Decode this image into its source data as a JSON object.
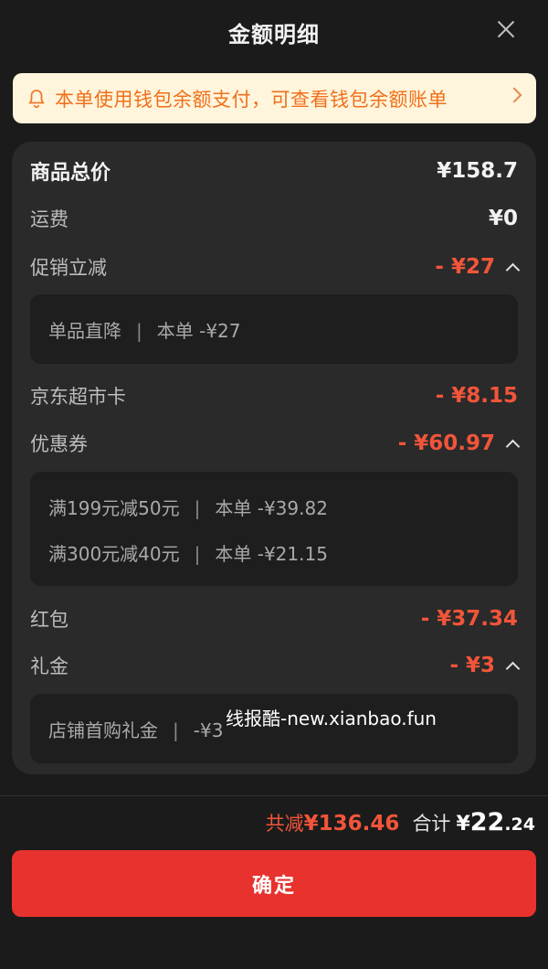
{
  "header": {
    "title": "金额明细"
  },
  "notice": {
    "text": "本单使用钱包余额支付，可查看钱包余额账单"
  },
  "rows": {
    "total": {
      "label": "商品总价",
      "amount": "¥158.7"
    },
    "shipping": {
      "label": "运费",
      "amount": "¥0"
    },
    "promo": {
      "label": "促销立减",
      "amount": "- ¥27",
      "details": [
        {
          "name": "单品直降",
          "value": "本单 -¥27"
        }
      ]
    },
    "jdcard": {
      "label": "京东超市卡",
      "amount": "- ¥8.15"
    },
    "coupon": {
      "label": "优惠券",
      "amount": "- ¥60.97",
      "details": [
        {
          "name": "满199元减50元",
          "value": "本单 -¥39.82"
        },
        {
          "name": "满300元减40元",
          "value": "本单 -¥21.15"
        }
      ]
    },
    "redpacket": {
      "label": "红包",
      "amount": "- ¥37.34"
    },
    "gift": {
      "label": "礼金",
      "amount": "- ¥3",
      "details": [
        {
          "name": "店铺首购礼金",
          "value": "-¥3"
        }
      ]
    }
  },
  "watermark": "线报酷-new.xianbao.fun",
  "summary": {
    "reduce_label": "共减",
    "reduce_value": "¥136.46",
    "total_label": "合计",
    "total_yen": "¥",
    "total_int": "22",
    "total_dec": ".24"
  },
  "confirm_label": "确定",
  "colors": {
    "accent_red": "#e8322e",
    "discount_red": "#f2553a",
    "notice_bg": "#fff5dc",
    "notice_text": "#f0701a"
  },
  "icons": {
    "notice": "bell-icon",
    "close": "close-icon",
    "arrow": "chevron-right-icon",
    "collapse": "chevron-up-icon"
  }
}
